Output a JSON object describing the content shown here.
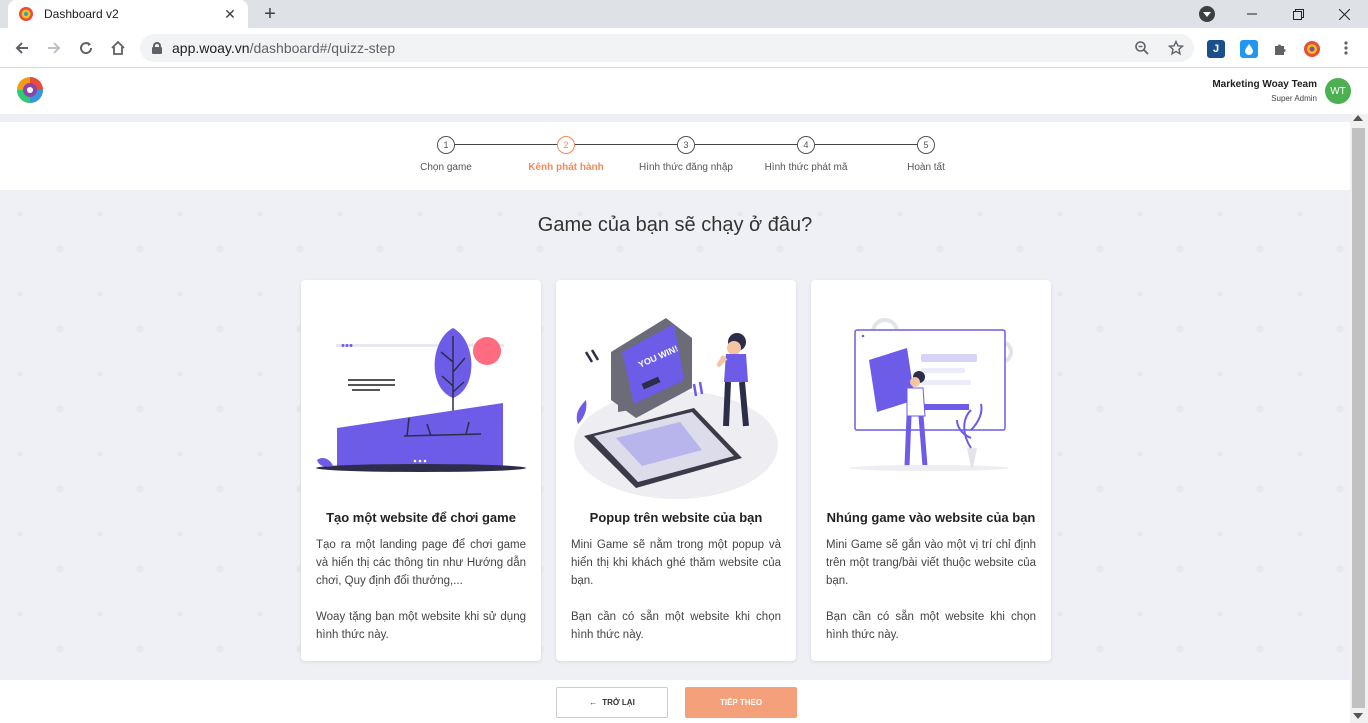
{
  "browser": {
    "tab_title": "Dashboard v2",
    "url_host": "app.woay.vn",
    "url_path": "/dashboard#/quizz-step",
    "new_tab": "+",
    "tab_close": "✕"
  },
  "header": {
    "user_name": "Marketing Woay Team",
    "user_role": "Super Admin",
    "avatar_initials": "WT"
  },
  "steps": [
    {
      "number": "1",
      "label": "Chọn game"
    },
    {
      "number": "2",
      "label": "Kênh phát hành",
      "active": true
    },
    {
      "number": "3",
      "label": "Hình thức đăng nhập"
    },
    {
      "number": "4",
      "label": "Hình thức phát mã"
    },
    {
      "number": "5",
      "label": "Hoàn tất"
    }
  ],
  "question": "Game của bạn sẽ chạy ở đâu?",
  "cards": [
    {
      "title": "Tạo một website để chơi game",
      "desc": "Tạo ra một landing page để chơi game và hiển thị các thông tin như Hướng dẫn chơi, Quy định đổi thưởng,...",
      "note": "Woay tặng bạn một website khi sử dụng hình thức này."
    },
    {
      "title": "Popup trên website của bạn",
      "desc": "Mini Game sẽ nằm trong một popup và hiển thị khi khách ghé thăm website của bạn.",
      "note": "Bạn cần có sẵn một website khi chọn hình thức này.",
      "illus_text": "YOU WIN!"
    },
    {
      "title": "Nhúng game vào website của bạn",
      "desc": "Mini Game sẽ gắn vào một vị trí chỉ định trên một trang/bài viết thuộc website của bạn.",
      "note": "Bạn cần có sẵn một website khi chọn hình thức này."
    }
  ],
  "footer": {
    "back_label": "TRỞ LẠI",
    "back_icon": "←",
    "next_label": "TIẾP THEO"
  },
  "colors": {
    "accent": "#f28b5b",
    "purple": "#6c5ce7",
    "avatar": "#4caf50"
  }
}
